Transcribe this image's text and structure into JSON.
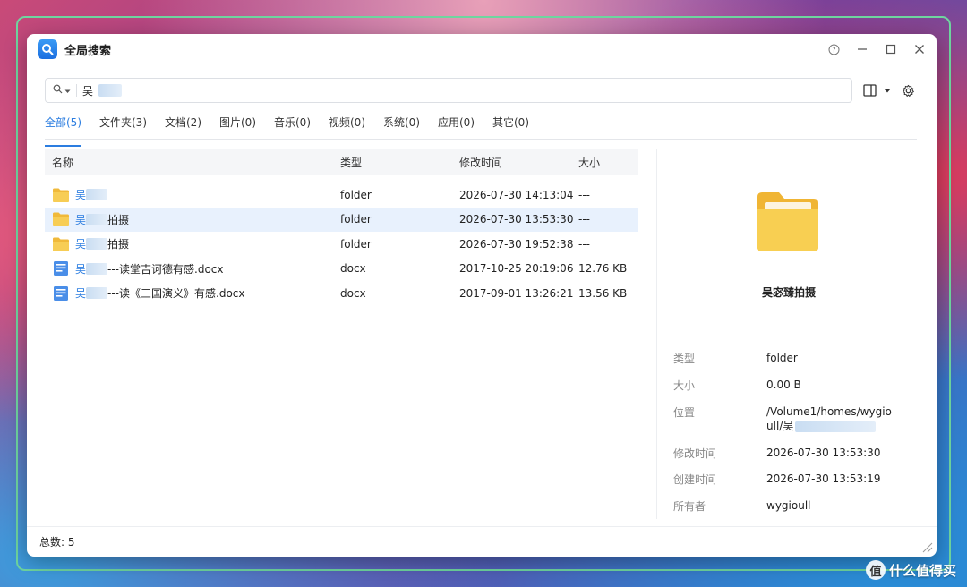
{
  "window": {
    "title": "全局搜索",
    "icons": {
      "app": "search-magnifier-icon",
      "help": "help-icon",
      "minimize": "minimize-icon",
      "maximize": "maximize-icon",
      "close": "close-icon"
    }
  },
  "search": {
    "query": "吴",
    "scope_icon": "search-icon",
    "layout_icon": "panel-layout-icon",
    "settings_icon": "gear-icon"
  },
  "tabs": [
    {
      "label": "全部(5)",
      "active": true
    },
    {
      "label": "文件夹(3)"
    },
    {
      "label": "文档(2)"
    },
    {
      "label": "图片(0)"
    },
    {
      "label": "音乐(0)"
    },
    {
      "label": "视频(0)"
    },
    {
      "label": "系统(0)"
    },
    {
      "label": "应用(0)"
    },
    {
      "label": "其它(0)"
    }
  ],
  "table": {
    "columns": [
      "名称",
      "类型",
      "修改时间",
      "大小"
    ],
    "rows": [
      {
        "name_prefix": "吴",
        "name_suffix": "",
        "type": "folder",
        "modified": "2026-07-30 14:13:04",
        "size": "---",
        "icon": "folder-icon"
      },
      {
        "name_prefix": "吴",
        "name_suffix": "拍摄",
        "type": "folder",
        "modified": "2026-07-30 13:53:30",
        "size": "---",
        "icon": "folder-icon",
        "selected": true
      },
      {
        "name_prefix": "吴",
        "name_suffix": "拍摄",
        "type": "folder",
        "modified": "2026-07-30 19:52:38",
        "size": "---",
        "icon": "folder-icon"
      },
      {
        "name_prefix": "吴",
        "name_suffix": "---读堂吉诃德有感.docx",
        "type": "docx",
        "modified": "2017-10-25 20:19:06",
        "size": "12.76 KB",
        "icon": "document-icon"
      },
      {
        "name_prefix": "吴",
        "name_suffix": "---读《三国演义》有感.docx",
        "type": "docx",
        "modified": "2017-09-01 13:26:21",
        "size": "13.56 KB",
        "icon": "document-icon"
      }
    ]
  },
  "detail": {
    "icon": "folder-icon",
    "name": "吴宓臻拍摄",
    "props": [
      {
        "label": "类型",
        "value": "folder"
      },
      {
        "label": "大小",
        "value": "0.00 B"
      },
      {
        "label": "位置",
        "value": "/Volume1/homes/wygioull/吴"
      },
      {
        "label": "修改时间",
        "value": "2026-07-30 13:53:30"
      },
      {
        "label": "创建时间",
        "value": "2026-07-30 13:53:19"
      },
      {
        "label": "所有者",
        "value": "wygioull"
      }
    ]
  },
  "footer": {
    "total": "总数: 5"
  },
  "watermark": {
    "glyph": "值",
    "text": "什么值得买"
  },
  "colors": {
    "accent": "#2b7de0",
    "selected_row": "#e8f1fd",
    "folder": "#f5c242"
  }
}
